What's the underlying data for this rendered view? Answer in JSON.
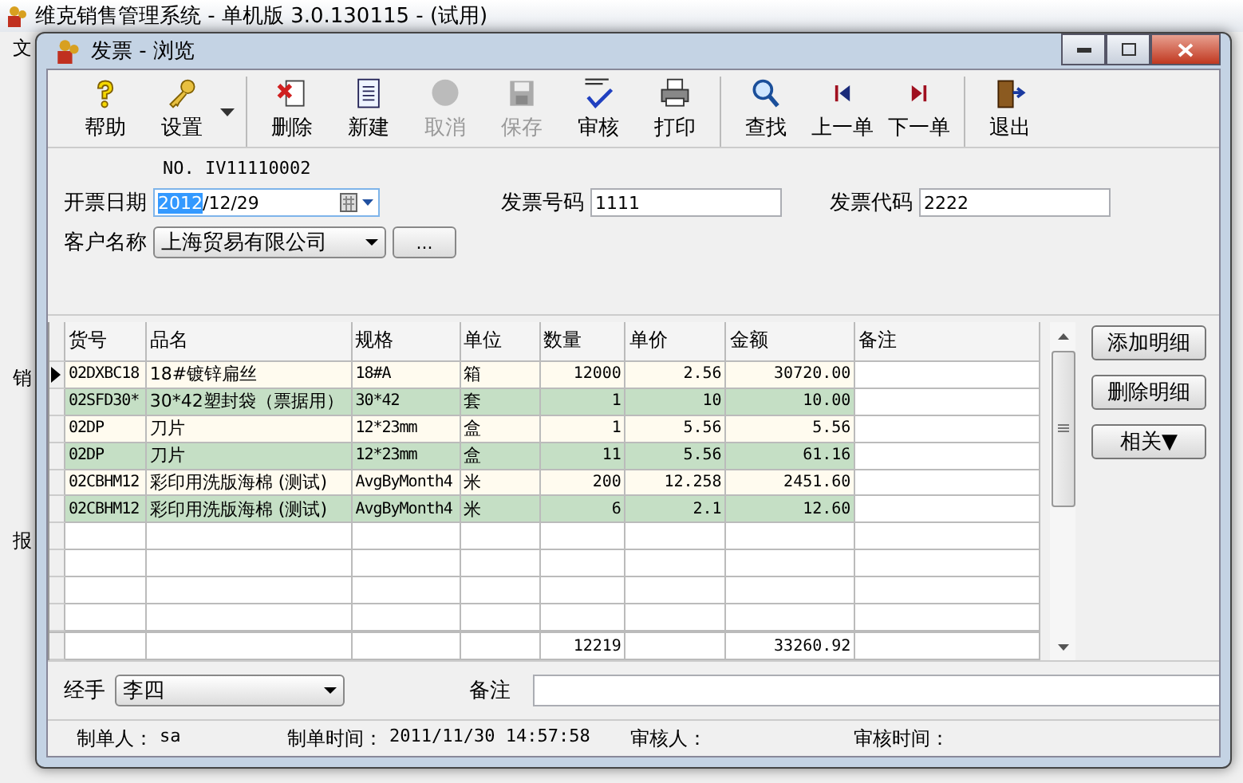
{
  "app": {
    "title": "维克销售管理系统 - 单机版 3.0.130115 - (试用)",
    "menu_item": "文",
    "side_labels": [
      "销",
      "报"
    ]
  },
  "dialog": {
    "title": "发票 - 浏览"
  },
  "toolbar": [
    [
      {
        "label": "帮助",
        "kind": "help",
        "disabled": false
      },
      {
        "label": "设置",
        "kind": "key",
        "disabled": false,
        "dropdown": true
      }
    ],
    [
      {
        "label": "删除",
        "kind": "delete",
        "disabled": false
      },
      {
        "label": "新建",
        "kind": "new",
        "disabled": false
      },
      {
        "label": "取消",
        "kind": "cancel",
        "disabled": true
      },
      {
        "label": "保存",
        "kind": "save",
        "disabled": true
      },
      {
        "label": "审核",
        "kind": "review",
        "disabled": false
      },
      {
        "label": "打印",
        "kind": "print",
        "disabled": false
      }
    ],
    [
      {
        "label": "查找",
        "kind": "find",
        "disabled": false
      },
      {
        "label": "上一单",
        "kind": "prev",
        "disabled": false
      },
      {
        "label": "下一单",
        "kind": "next",
        "disabled": false
      }
    ],
    [
      {
        "label": "退出",
        "kind": "exit",
        "disabled": false
      }
    ]
  ],
  "form": {
    "number": "NO. IV11110002",
    "date_label": "开票日期",
    "date_selected_part": "2012",
    "date_rest": "/12/29",
    "invoice_no_label": "发票号码",
    "invoice_no": "1111",
    "invoice_code_label": "发票代码",
    "invoice_code": "2222",
    "customer_label": "客户名称",
    "customer": "上海贸易有限公司",
    "browse_button": "..."
  },
  "grid": {
    "columns": [
      "货号",
      "品名",
      "规格",
      "单位",
      "数量",
      "单价",
      "金额",
      "备注"
    ],
    "rows": [
      {
        "selected": true,
        "cells": [
          "02DXBC18",
          "18#镀锌扁丝",
          "18#A",
          "箱",
          "12000",
          "2.56",
          "30720.00"
        ]
      },
      {
        "selected": false,
        "cells": [
          "02SFD30*",
          "30*42塑封袋（票据用）",
          "30*42",
          "套",
          "1",
          "10",
          "10.00"
        ]
      },
      {
        "selected": false,
        "cells": [
          "02DP",
          "刀片",
          "12*23mm",
          "盒",
          "1",
          "5.56",
          "5.56"
        ]
      },
      {
        "selected": false,
        "cells": [
          "02DP",
          "刀片",
          "12*23mm",
          "盒",
          "11",
          "5.56",
          "61.16"
        ]
      },
      {
        "selected": false,
        "cells": [
          "02CBHM12",
          "彩印用洗版海棉 (测试)",
          "AvgByMonth4",
          "米",
          "200",
          "12.258",
          "2451.60"
        ]
      },
      {
        "selected": false,
        "cells": [
          "02CBHM12",
          "彩印用洗版海棉 (测试)",
          "AvgByMonth4",
          "米",
          "6",
          "2.1",
          "12.60"
        ]
      }
    ],
    "total_quantity": "12219",
    "total_amount": "33260.92"
  },
  "side_buttons": [
    "添加明细",
    "删除明细",
    "相关▼"
  ],
  "bottom": {
    "handler_label": "经手",
    "handler": "李四",
    "note_label": "备注"
  },
  "status_bar": [
    {
      "label": "制单人：",
      "value": "sa"
    },
    {
      "label": "制单时间：",
      "value": "2011/11/30 14:57:58"
    },
    {
      "label": "审核人："
    },
    {
      "label": "审核时间："
    }
  ]
}
